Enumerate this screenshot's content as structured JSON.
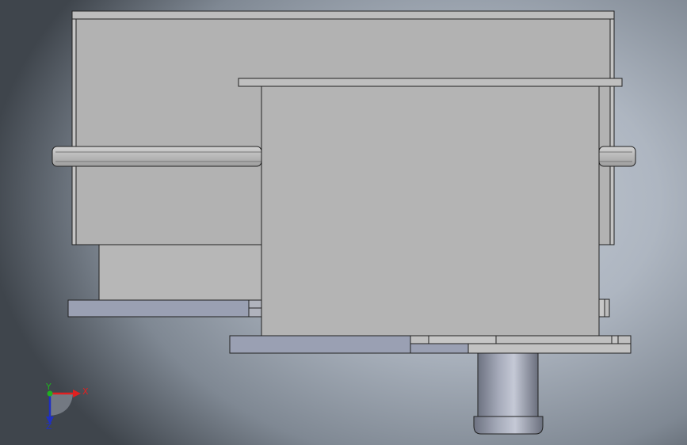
{
  "viewport": {
    "background_center": "#c2c9d3",
    "background_edge": "#3f454c",
    "part_fill": "#b4b4b4",
    "part_fill_light": "#bebebe",
    "base_fill": "#9aa0b3",
    "edge_color": "#222222"
  },
  "triad": {
    "x_label": "X",
    "y_label": "Y",
    "z_label": "Z",
    "x_color": "#e02020",
    "y_color": "#20b020",
    "z_color": "#2030c0"
  }
}
